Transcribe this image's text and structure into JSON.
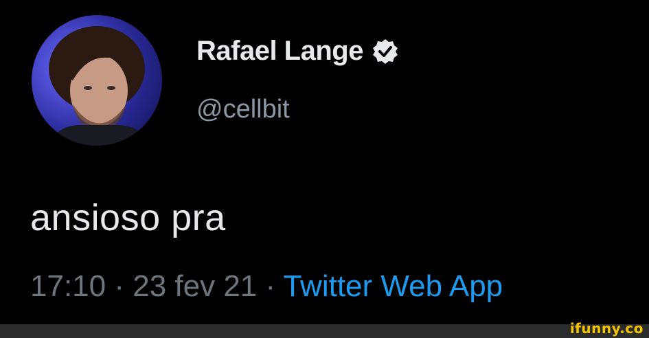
{
  "tweet": {
    "author": {
      "display_name": "Rafael Lange",
      "handle": "@cellbit",
      "verified_icon": "verified-badge-icon"
    },
    "text": "ansioso pra",
    "time": "17:10",
    "separator": "·",
    "date": "23 fev 21",
    "source": "Twitter Web App"
  },
  "watermark": "ifunny.co",
  "colors": {
    "background": "#000000",
    "text_primary": "#e7e9ea",
    "text_secondary": "#8b98a5",
    "link": "#1d9bf0",
    "watermark": "#f5c400"
  }
}
